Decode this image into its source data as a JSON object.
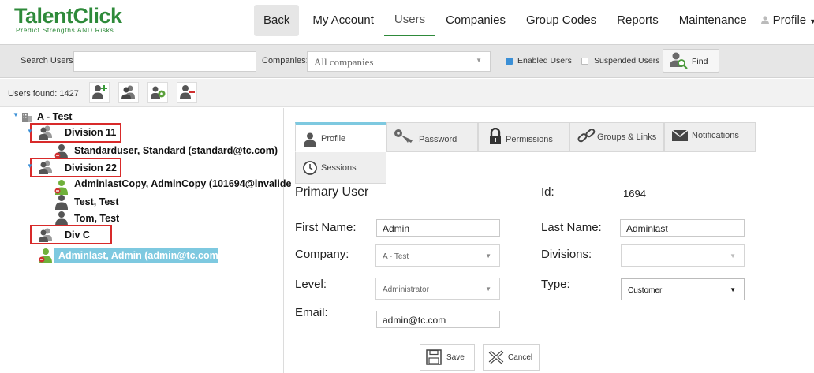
{
  "logo": {
    "name": "TalentClick",
    "tagline": "Predict Strengths AND Risks."
  },
  "nav": {
    "back": "Back",
    "my_account": "My Account",
    "users": "Users",
    "companies": "Companies",
    "group_codes": "Group Codes",
    "reports": "Reports",
    "maintenance": "Maintenance",
    "profile": "Profile"
  },
  "search": {
    "label": "Search Users:",
    "value": "",
    "companies_label": "Companies:",
    "companies_value": "All companies",
    "enabled_label": "Enabled Users",
    "suspended_label": "Suspended Users",
    "find_label": "Find"
  },
  "users_bar": {
    "found": "Users found: 1427"
  },
  "tree": {
    "root": "A - Test",
    "division11": "Division 11",
    "user_standard": "Standarduser, Standard  (standard@tc.com)",
    "division22": "Division 22",
    "user_admincopy": "AdminlastCopy, AdminCopy  (101694@invalide",
    "user_test": "Test, Test",
    "user_tom": "Tom, Test",
    "divc": "Div C",
    "user_admin": "Adminlast, Admin  (admin@tc.com)"
  },
  "tabs": {
    "profile": "Profile",
    "password": "Password",
    "permissions": "Permissions",
    "groups_links": "Groups & Links",
    "notifications": "Notifications",
    "sessions": "Sessions"
  },
  "form": {
    "section_title": "Primary User",
    "id_label": "Id:",
    "id_value": "1694",
    "first_name_label": "First Name:",
    "first_name_value": "Admin",
    "last_name_label": "Last Name:",
    "last_name_value": "Adminlast",
    "company_label": "Company:",
    "company_value": "A - Test",
    "divisions_label": "Divisions:",
    "divisions_value": "",
    "level_label": "Level:",
    "level_value": "Administrator",
    "type_label": "Type:",
    "type_value": "Customer",
    "email_label": "Email:",
    "email_value": "admin@tc.com",
    "save_label": "Save",
    "cancel_label": "Cancel"
  },
  "colors": {
    "brand_green": "#2e8a3a",
    "selected_blue": "#7ec9e0",
    "highlight_red": "#d82a2a"
  }
}
